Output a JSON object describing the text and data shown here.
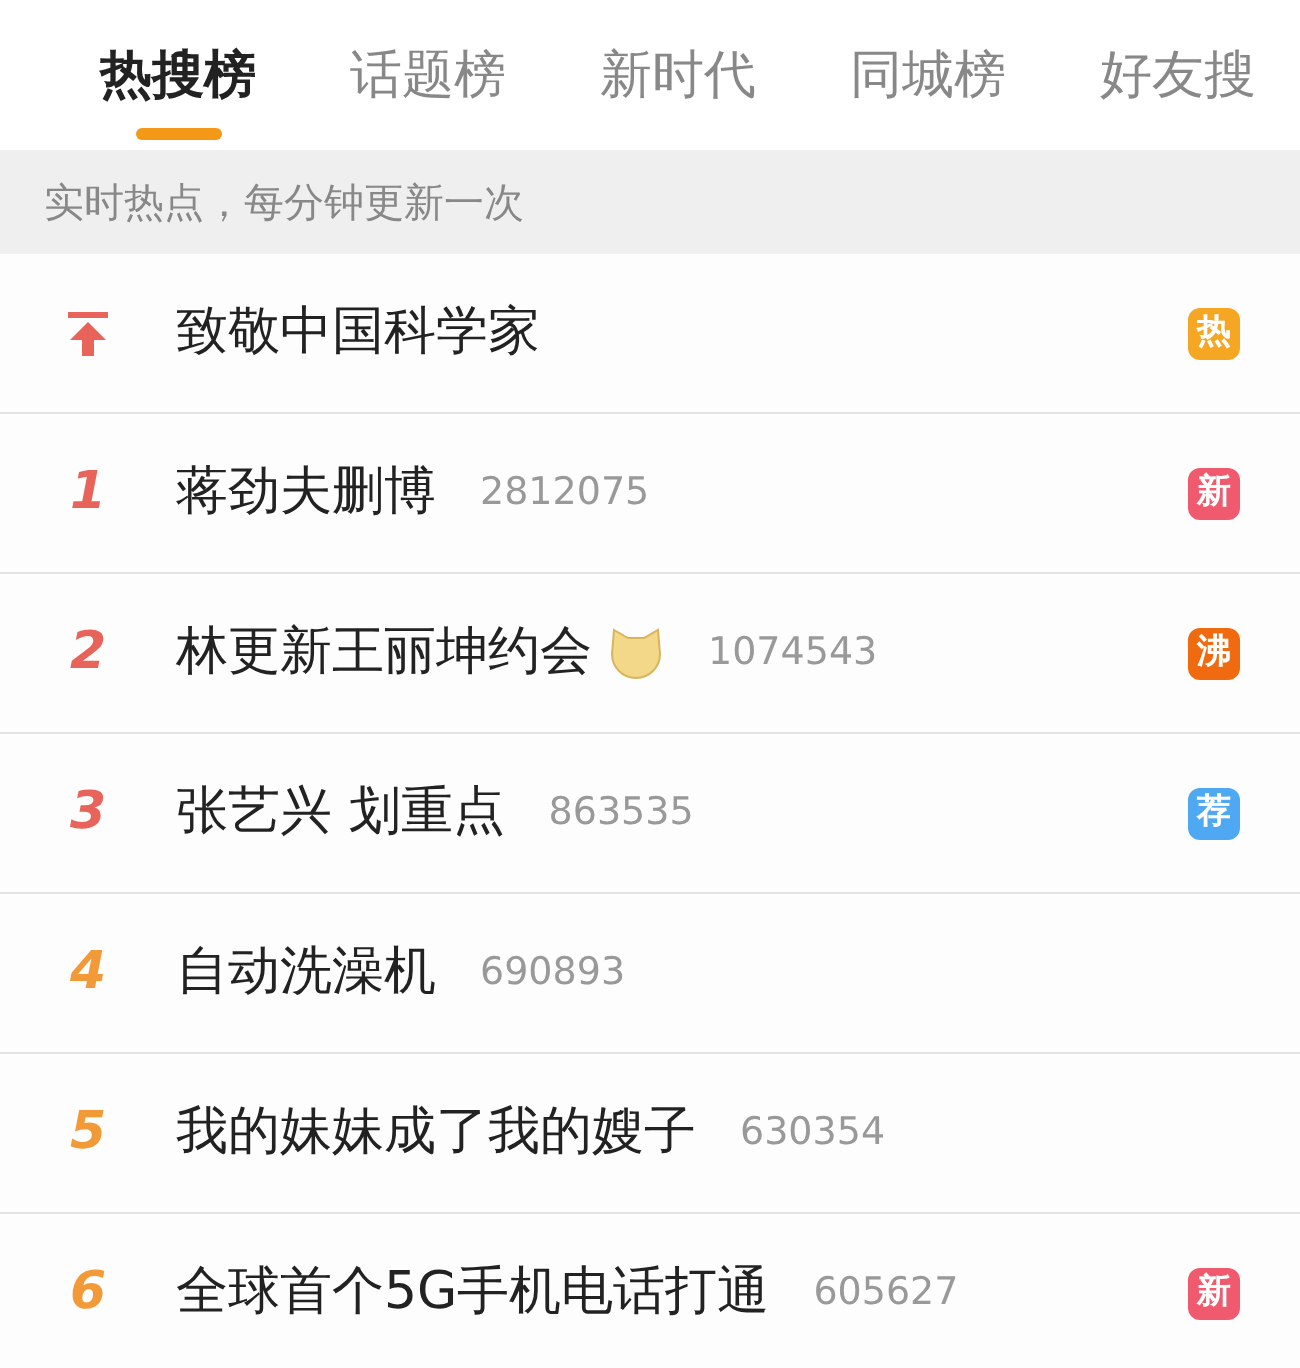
{
  "tabs": [
    {
      "label": "热搜榜",
      "selected": true
    },
    {
      "label": "话题榜",
      "selected": false
    },
    {
      "label": "新时代",
      "selected": false
    },
    {
      "label": "同城榜",
      "selected": false
    },
    {
      "label": "好友搜",
      "selected": false
    }
  ],
  "notice": "实时热点，每分钟更新一次",
  "items": [
    {
      "kind": "pinned",
      "title": "致敬中国科学家",
      "badge": {
        "text": "热",
        "color": "#f5a623"
      }
    },
    {
      "kind": "top",
      "rank": "1",
      "title": "蒋劲夫删博",
      "count": "2812075",
      "badge": {
        "text": "新",
        "color": "#ef5a6f"
      }
    },
    {
      "kind": "top",
      "rank": "2",
      "title": "林更新王丽坤约会",
      "emoji": true,
      "count": "1074543",
      "badge": {
        "text": "沸",
        "color": "#f06a0f"
      }
    },
    {
      "kind": "top",
      "rank": "3",
      "title": "张艺兴 划重点",
      "count": "863535",
      "badge": {
        "text": "荐",
        "color": "#4ea9f2"
      }
    },
    {
      "kind": "regular",
      "rank": "4",
      "title": "自动洗澡机",
      "count": "690893"
    },
    {
      "kind": "regular",
      "rank": "5",
      "title": "我的妹妹成了我的嫂子",
      "count": "630354"
    },
    {
      "kind": "regular",
      "rank": "6",
      "title": "全球首个5G手机电话打通",
      "count": "605627",
      "badge": {
        "text": "新",
        "color": "#ef5a6f"
      }
    }
  ]
}
